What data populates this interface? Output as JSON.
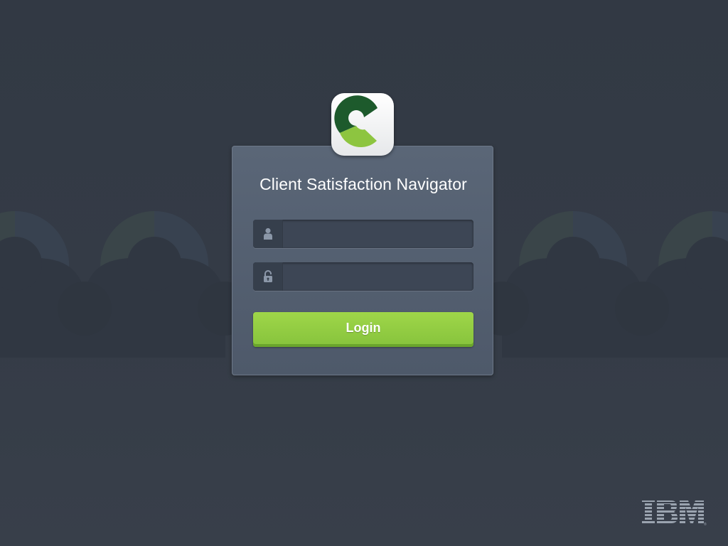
{
  "app": {
    "title": "Client Satisfaction Navigator",
    "icon": "c-logo-icon"
  },
  "login_form": {
    "username": {
      "icon": "user-icon",
      "value": "",
      "placeholder": ""
    },
    "password": {
      "icon": "lock-icon",
      "value": "",
      "placeholder": ""
    },
    "login_label": "Login"
  },
  "branding": {
    "company_logo": "IBM",
    "icon": "ibm-logo-icon"
  },
  "colors": {
    "background": "#343b46",
    "card": "#556172",
    "accent_green": "#8cc63f",
    "dark_green": "#1f5a2c",
    "field": "#3d4655"
  }
}
